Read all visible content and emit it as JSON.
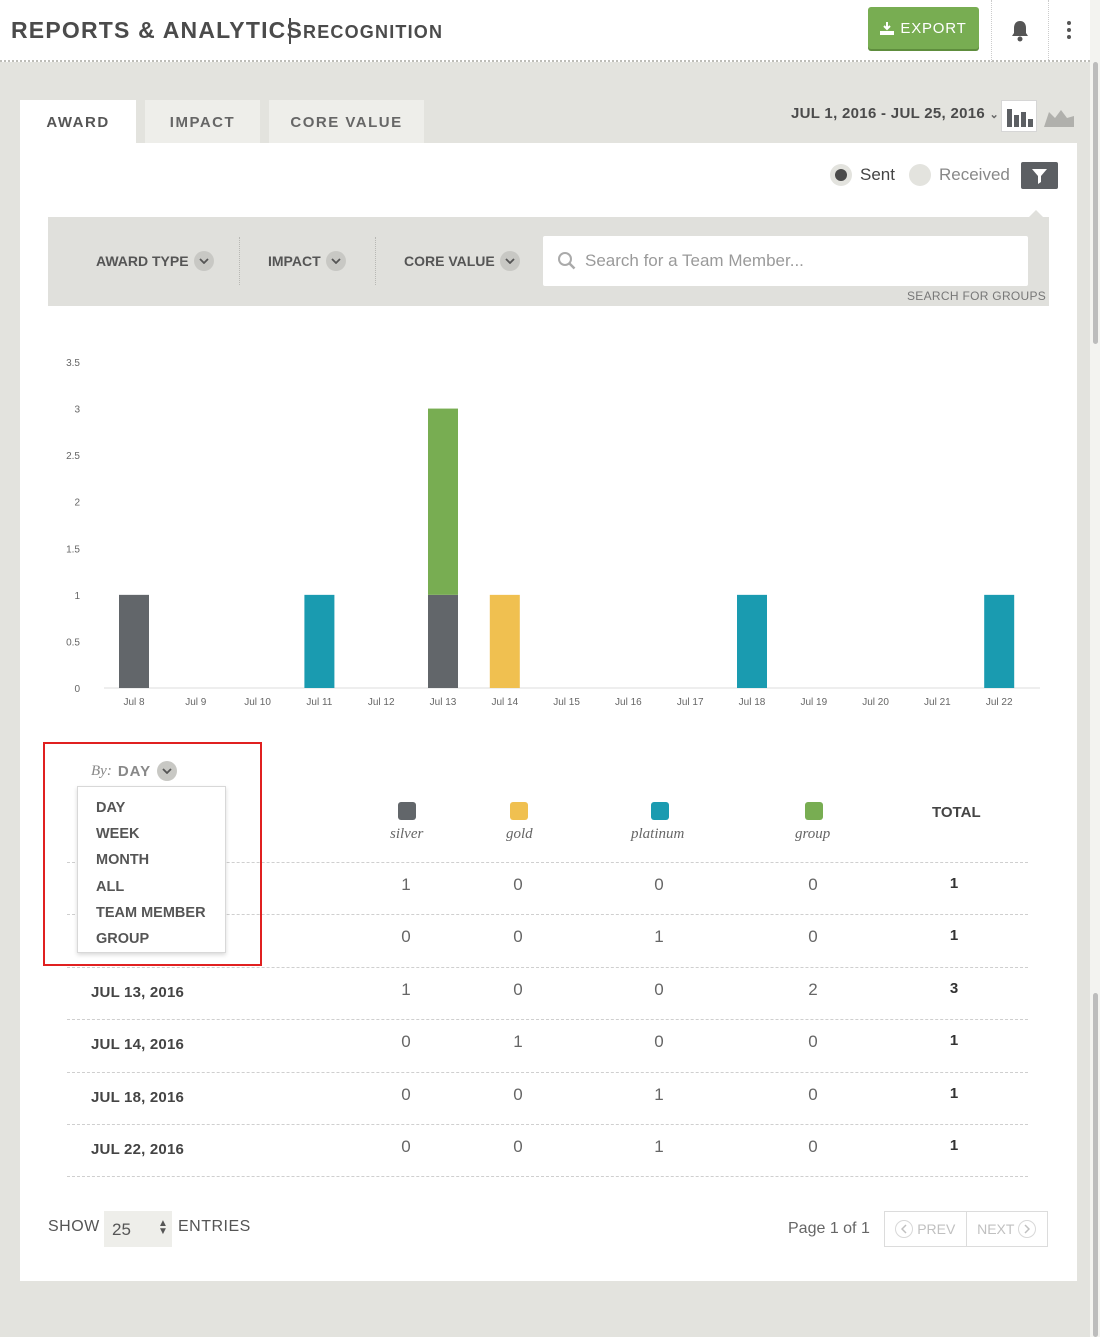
{
  "header": {
    "title": "REPORTS & ANALYTICS",
    "subtitle": "RECOGNITION",
    "export_label": "EXPORT"
  },
  "tabs": [
    {
      "label": "AWARD",
      "active": true
    },
    {
      "label": "IMPACT",
      "active": false
    },
    {
      "label": "CORE VALUE",
      "active": false
    }
  ],
  "date_range": "JUL 1, 2016 - JUL 25, 2016",
  "direction": {
    "sent": "Sent",
    "received": "Received",
    "selected": "Sent"
  },
  "filters": {
    "award_type": "AWARD TYPE",
    "impact": "IMPACT",
    "core_value": "CORE VALUE",
    "search_placeholder": "Search for a Team Member...",
    "search_groups": "SEARCH FOR GROUPS"
  },
  "colors": {
    "silver": "#62666a",
    "gold": "#f0c050",
    "platinum": "#1a9bb0",
    "group": "#78ad52",
    "accent": "#78ad52"
  },
  "chart_data": {
    "type": "bar",
    "stacked": true,
    "categories": [
      "Jul 8",
      "Jul 9",
      "Jul 10",
      "Jul 11",
      "Jul 12",
      "Jul 13",
      "Jul 14",
      "Jul 15",
      "Jul 16",
      "Jul 17",
      "Jul 18",
      "Jul 19",
      "Jul 20",
      "Jul 21",
      "Jul 22"
    ],
    "series": [
      {
        "name": "silver",
        "values": [
          1,
          0,
          0,
          0,
          0,
          1,
          0,
          0,
          0,
          0,
          0,
          0,
          0,
          0,
          0
        ]
      },
      {
        "name": "gold",
        "values": [
          0,
          0,
          0,
          0,
          0,
          0,
          1,
          0,
          0,
          0,
          0,
          0,
          0,
          0,
          0
        ]
      },
      {
        "name": "platinum",
        "values": [
          0,
          0,
          0,
          1,
          0,
          0,
          0,
          0,
          0,
          0,
          1,
          0,
          0,
          0,
          1
        ]
      },
      {
        "name": "group",
        "values": [
          0,
          0,
          0,
          0,
          0,
          2,
          0,
          0,
          0,
          0,
          0,
          0,
          0,
          0,
          0
        ]
      }
    ],
    "yticks": [
      "0",
      "0.5",
      "1",
      "1.5",
      "2",
      "2.5",
      "3",
      "3.5"
    ],
    "ylim": [
      0,
      3.5
    ]
  },
  "group_by": {
    "label": "By:",
    "selected": "DAY",
    "options": [
      "DAY",
      "WEEK",
      "MONTH",
      "ALL",
      "TEAM MEMBER",
      "GROUP"
    ]
  },
  "table": {
    "columns": [
      "silver",
      "gold",
      "platinum",
      "group"
    ],
    "total_label": "TOTAL",
    "rows": [
      {
        "date": "",
        "silver": "1",
        "gold": "0",
        "platinum": "0",
        "group": "0",
        "total": "1"
      },
      {
        "date": "",
        "silver": "0",
        "gold": "0",
        "platinum": "1",
        "group": "0",
        "total": "1"
      },
      {
        "date": "JUL 13, 2016",
        "silver": "1",
        "gold": "0",
        "platinum": "0",
        "group": "2",
        "total": "3"
      },
      {
        "date": "JUL 14, 2016",
        "silver": "0",
        "gold": "1",
        "platinum": "0",
        "group": "0",
        "total": "1"
      },
      {
        "date": "JUL 18, 2016",
        "silver": "0",
        "gold": "0",
        "platinum": "1",
        "group": "0",
        "total": "1"
      },
      {
        "date": "JUL 22, 2016",
        "silver": "0",
        "gold": "0",
        "platinum": "1",
        "group": "0",
        "total": "1"
      }
    ]
  },
  "footer": {
    "show": "SHOW",
    "entries_value": "25",
    "entries": "ENTRIES",
    "page_info": "Page 1 of 1",
    "prev": "PREV",
    "next": "NEXT"
  }
}
